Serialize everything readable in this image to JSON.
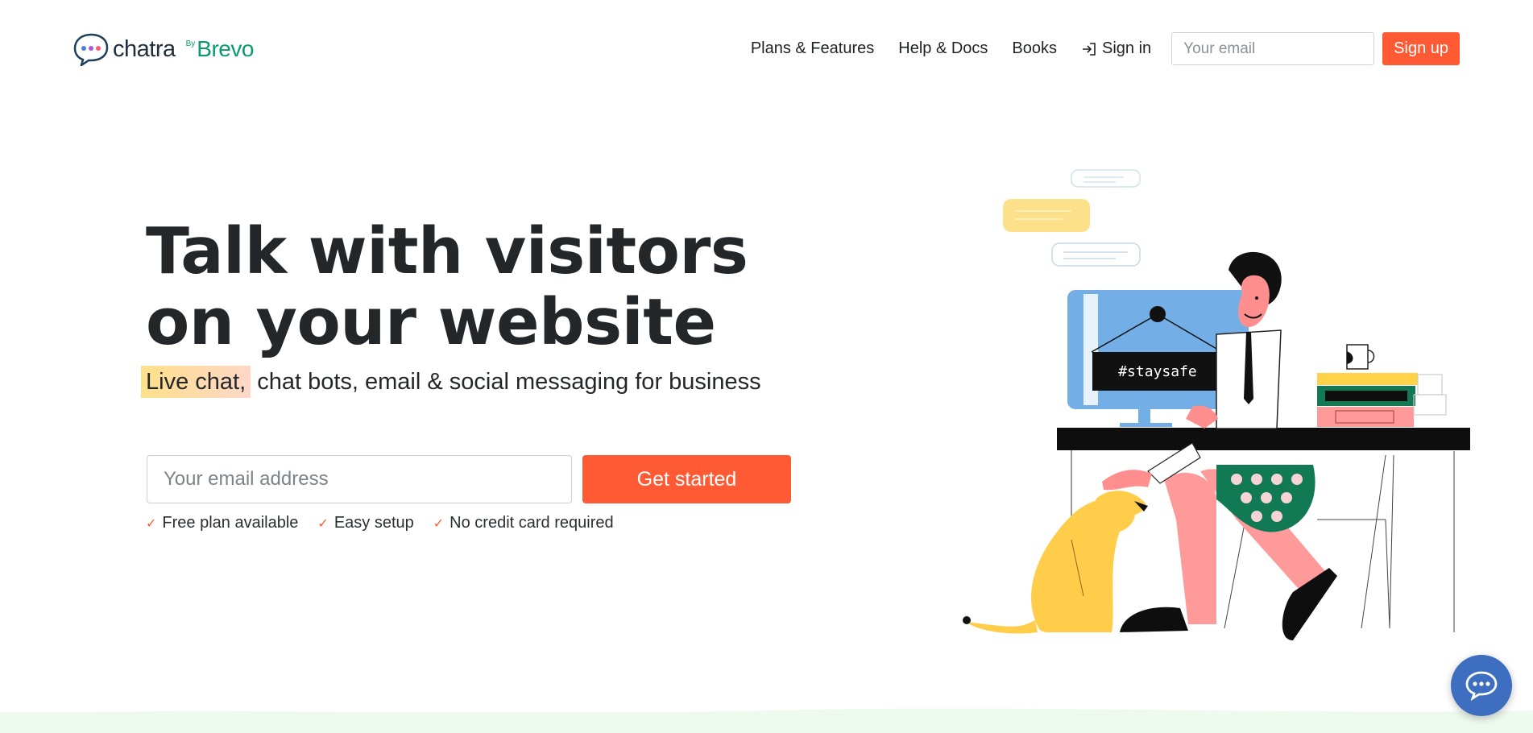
{
  "brand": {
    "name": "chatra",
    "by": "By",
    "partner": "Brevo"
  },
  "nav": {
    "items": [
      {
        "label": "Plans & Features"
      },
      {
        "label": "Help & Docs"
      },
      {
        "label": "Books"
      }
    ],
    "signin_label": "Sign in",
    "email_placeholder": "Your email",
    "signup_label": "Sign up"
  },
  "hero": {
    "title_line1": "Talk with visitors",
    "title_line2": "on your website",
    "subtitle_highlight": "Live chat,",
    "subtitle_rest": " chat bots, email & social messaging for business",
    "email_placeholder": "Your email address",
    "cta_label": "Get started",
    "checks": [
      {
        "label": "Free plan available"
      },
      {
        "label": "Easy setup"
      },
      {
        "label": "No credit card required"
      }
    ]
  },
  "illustration": {
    "sign_text": "#staysafe"
  },
  "colors": {
    "accent": "#ff5a34",
    "brand_green": "#0b996e",
    "chat_widget": "#3d6ebf",
    "band": "#effaef"
  },
  "icons": {
    "logo": "chat-bubble-dots-icon",
    "signin": "sign-in-arrow-icon",
    "check": "checkmark-icon",
    "chat_widget": "chat-bubble-icon"
  }
}
